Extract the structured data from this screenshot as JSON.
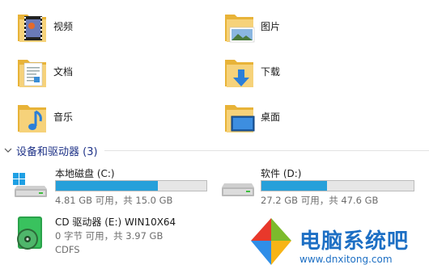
{
  "folders": [
    {
      "label": "视频",
      "icon": "video-folder-icon"
    },
    {
      "label": "图片",
      "icon": "pictures-folder-icon"
    },
    {
      "label": "文档",
      "icon": "documents-folder-icon"
    },
    {
      "label": "下载",
      "icon": "downloads-folder-icon"
    },
    {
      "label": "音乐",
      "icon": "music-folder-icon"
    },
    {
      "label": "桌面",
      "icon": "desktop-folder-icon"
    }
  ],
  "devices_section": {
    "title": "设备和驱动器 (3)",
    "icon": "chevron-down-icon"
  },
  "drives": [
    {
      "name": "本地磁盘 (C:)",
      "detail": "4.81 GB 可用，共 15.0 GB",
      "used_fraction": 0.68,
      "icon": "windows-drive-icon"
    },
    {
      "name": "软件 (D:)",
      "detail": "27.2 GB 可用，共 47.6 GB",
      "used_fraction": 0.43,
      "icon": "hard-drive-icon"
    },
    {
      "name": "CD 驱动器 (E:) WIN10X64",
      "detail": "0 字节 可用，共 3.97 GB",
      "filesystem": "CDFS",
      "icon": "cd-drive-icon"
    }
  ],
  "watermark": {
    "brand": "电脑系统吧",
    "url": "www.dnxitong.com",
    "icon": "office-logo-icon"
  },
  "colors": {
    "accent": "#26a0da",
    "section_title": "#1e3287",
    "folder_yellow": "#f4c956"
  }
}
